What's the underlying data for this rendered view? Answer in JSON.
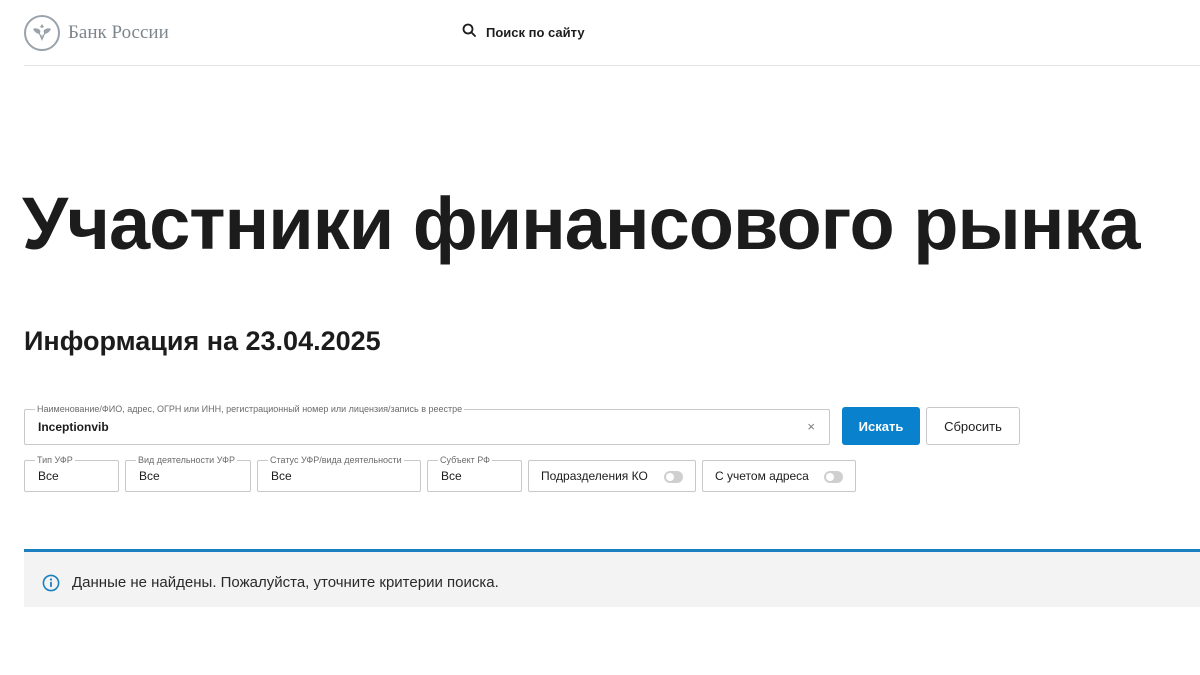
{
  "header": {
    "logo_text": "Банк России",
    "search_label": "Поиск по сайту"
  },
  "page": {
    "title": "Участники финансового рынка",
    "info_date": "Информация на 23.04.2025"
  },
  "search": {
    "field_label": "Наименование/ФИО, адрес, ОГРН или ИНН, регистрационный номер или лицензия/запись в реестре",
    "value": "Inceptionvib",
    "clear_glyph": "×",
    "submit_label": "Искать",
    "reset_label": "Сбросить"
  },
  "filters": [
    {
      "label": "Тип УФР",
      "value": "Все"
    },
    {
      "label": "Вид деятельности УФР",
      "value": "Все"
    },
    {
      "label": "Статус УФР/вида деятельности",
      "value": "Все"
    },
    {
      "label": "Субъект РФ",
      "value": "Все"
    }
  ],
  "toggles": [
    {
      "label": "Подразделения КО",
      "on": false
    },
    {
      "label": "С учетом адреса",
      "on": false
    }
  ],
  "alert": {
    "icon": "info-icon",
    "message": "Данные не найдены. Пожалуйста, уточните критерии поиска."
  },
  "colors": {
    "accent": "#0a81cc",
    "alert_border": "#1b7fc1",
    "logo_grey": "#7e868d"
  }
}
